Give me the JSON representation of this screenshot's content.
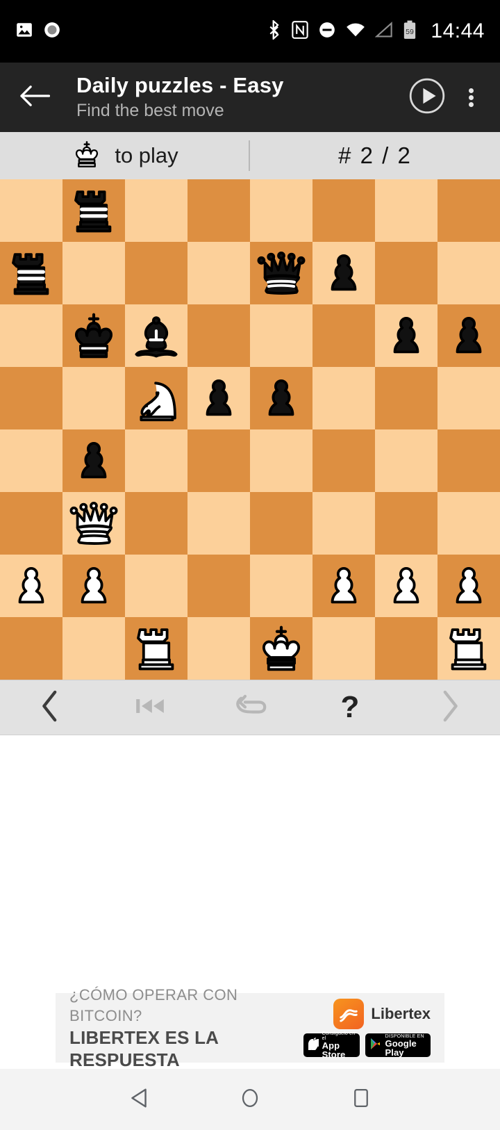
{
  "status_bar": {
    "left_icons": [
      "screenshot-image-icon",
      "screen-record-icon"
    ],
    "right_icons": [
      "bluetooth-icon",
      "nfc-icon",
      "do-not-disturb-icon",
      "wifi-icon",
      "cell-signal-icon",
      "battery-icon"
    ],
    "battery_level": "59",
    "time": "14:44"
  },
  "app_bar": {
    "back_label": "Back",
    "title": "Daily puzzles - Easy",
    "subtitle": "Find the best move",
    "play_label": "Play",
    "overflow_label": "More options"
  },
  "info_bar": {
    "side_to_move": "white",
    "to_play_text": "to play",
    "puzzle_counter": "# 2 / 2"
  },
  "board": {
    "light_color": "#fcd09a",
    "dark_color": "#dd8f41",
    "orientation": "white",
    "files": [
      "a",
      "b",
      "c",
      "d",
      "e",
      "f",
      "g",
      "h"
    ],
    "ranks": [
      "8",
      "7",
      "6",
      "5",
      "4",
      "3",
      "2",
      "1"
    ],
    "fen": "1r6/r3qp2/1kb3pp/2Npp3/1p6/1Q6/PP3PPP/2R1K2R",
    "pieces": [
      {
        "square": "b8",
        "color": "black",
        "type": "rook"
      },
      {
        "square": "a7",
        "color": "black",
        "type": "rook"
      },
      {
        "square": "e7",
        "color": "black",
        "type": "queen"
      },
      {
        "square": "f7",
        "color": "black",
        "type": "pawn"
      },
      {
        "square": "b6",
        "color": "black",
        "type": "king"
      },
      {
        "square": "c6",
        "color": "black",
        "type": "bishop"
      },
      {
        "square": "g6",
        "color": "black",
        "type": "pawn"
      },
      {
        "square": "h6",
        "color": "black",
        "type": "pawn"
      },
      {
        "square": "c5",
        "color": "white",
        "type": "knight"
      },
      {
        "square": "d5",
        "color": "black",
        "type": "pawn"
      },
      {
        "square": "e5",
        "color": "black",
        "type": "pawn"
      },
      {
        "square": "b4",
        "color": "black",
        "type": "pawn"
      },
      {
        "square": "b3",
        "color": "white",
        "type": "queen"
      },
      {
        "square": "a2",
        "color": "white",
        "type": "pawn"
      },
      {
        "square": "b2",
        "color": "white",
        "type": "pawn"
      },
      {
        "square": "f2",
        "color": "white",
        "type": "pawn"
      },
      {
        "square": "g2",
        "color": "white",
        "type": "pawn"
      },
      {
        "square": "h2",
        "color": "white",
        "type": "pawn"
      },
      {
        "square": "c1",
        "color": "white",
        "type": "rook"
      },
      {
        "square": "e1",
        "color": "white",
        "type": "king"
      },
      {
        "square": "h1",
        "color": "white",
        "type": "rook"
      }
    ]
  },
  "toolbar": {
    "buttons": [
      {
        "name": "previous-puzzle-button",
        "icon": "chevron-left-icon",
        "enabled": true
      },
      {
        "name": "first-move-button",
        "icon": "skip-to-start-icon",
        "enabled": false
      },
      {
        "name": "undo-move-button",
        "icon": "undo-icon",
        "enabled": false
      },
      {
        "name": "hint-button",
        "icon": "question-mark-icon",
        "glyph": "?",
        "enabled": true
      },
      {
        "name": "next-puzzle-button",
        "icon": "chevron-right-icon",
        "enabled": false
      }
    ]
  },
  "ad": {
    "headline": "¿CÓMO OPERAR CON BITCOIN?",
    "subhead": "LIBERTEX ES LA RESPUESTA",
    "brand": "Libertex",
    "app_store": {
      "small": "Consíguelo en el",
      "big": "App Store"
    },
    "google_play": {
      "small": "DISPONIBLE EN",
      "big": "Google Play"
    }
  },
  "nav_bar": {
    "back_label": "Back",
    "home_label": "Home",
    "recents_label": "Recents"
  }
}
